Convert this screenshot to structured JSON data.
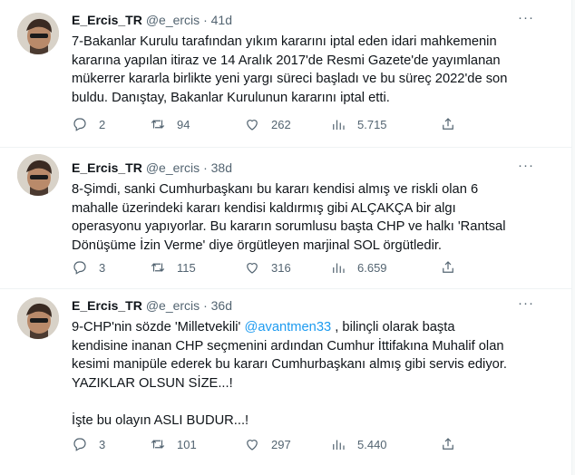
{
  "tweets": [
    {
      "name": "E_Ercis_TR",
      "handle": "@e_ercis",
      "time": "41d",
      "text": "7-Bakanlar Kurulu tarafından yıkım kararını iptal eden idari mahkemenin\nkararına yapılan itiraz ve 14 Aralık 2017'de Resmi Gazete'de yayımlanan\nmükerrer kararla birlikte yeni yargı süreci başladı ve bu süreç 2022'de son\nbuldu. Danıştay, Bakanlar Kurulunun kararını iptal etti.",
      "replies": "2",
      "retweets": "94",
      "likes": "262",
      "views": "5.715"
    },
    {
      "name": "E_Ercis_TR",
      "handle": "@e_ercis",
      "time": "38d",
      "text": "8-Şimdi, sanki Cumhurbaşkanı bu kararı kendisi almış ve riskli olan 6\nmahalle üzerindeki kararı kendisi kaldırmış gibi ALÇAKÇA bir algı\noperasyonu yapıyorlar. Bu kararın sorumlusu başta CHP ve halkı 'Rantsal\nDönüşüme İzin Verme' diye örgütleyen marjinal SOL örgütledir.",
      "replies": "3",
      "retweets": "115",
      "likes": "316",
      "views": "6.659"
    },
    {
      "name": "E_Ercis_TR",
      "handle": "@e_ercis",
      "time": "36d",
      "text_before": "9-CHP'nin sözde 'Milletvekili' ",
      "mention": "@avantmen33",
      "text_after": " , bilinçli olarak başta\nkendisine inanan CHP seçmenini ardından Cumhur İttifakına Muhalif olan\nkesimi manipüle ederek bu kararı Cumhurbaşkanı almış gibi servis ediyor.\nYAZIKLAR OLSUN SİZE...!\n\nİşte bu olayın ASLI BUDUR...!",
      "replies": "3",
      "retweets": "101",
      "likes": "297",
      "views": "5.440"
    }
  ],
  "separator": "·",
  "more_glyph": "···",
  "colors": {
    "accent": "#1d9bf0",
    "muted": "#536471",
    "text": "#0f1419"
  },
  "icons": [
    "reply-icon",
    "retweet-icon",
    "like-icon",
    "views-icon",
    "share-icon",
    "more-icon"
  ]
}
